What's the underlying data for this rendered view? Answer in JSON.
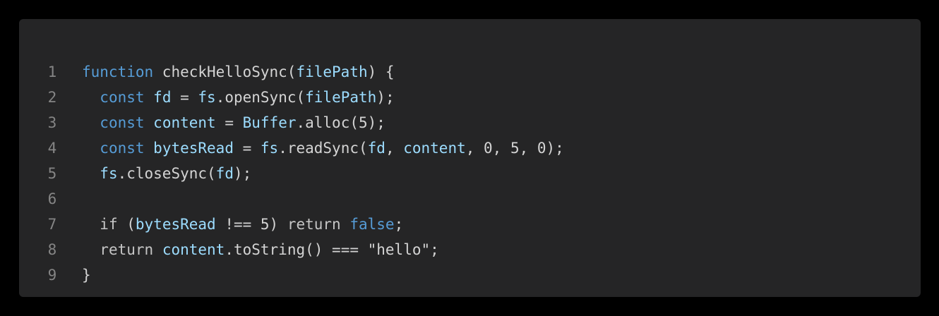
{
  "colors": {
    "background": "#000000",
    "panel": "#252526",
    "text": "#d4d4d4",
    "line_number": "#858585",
    "keyword": "#569cd6",
    "variable": "#9cdcfe"
  },
  "code": {
    "line_numbers": [
      "1",
      "2",
      "3",
      "4",
      "5",
      "6",
      "7",
      "8",
      "9"
    ],
    "lines": [
      [
        {
          "t": "function",
          "k": "kw"
        },
        {
          "t": " checkHelloSync(",
          "k": "fn"
        },
        {
          "t": "filePath",
          "k": "var"
        },
        {
          "t": ") {",
          "k": "punc"
        }
      ],
      [
        {
          "t": "  ",
          "k": "punc"
        },
        {
          "t": "const",
          "k": "kw"
        },
        {
          "t": " ",
          "k": "punc"
        },
        {
          "t": "fd",
          "k": "var"
        },
        {
          "t": " = ",
          "k": "punc"
        },
        {
          "t": "fs",
          "k": "var"
        },
        {
          "t": ".openSync(",
          "k": "fn"
        },
        {
          "t": "filePath",
          "k": "var"
        },
        {
          "t": ");",
          "k": "punc"
        }
      ],
      [
        {
          "t": "  ",
          "k": "punc"
        },
        {
          "t": "const",
          "k": "kw"
        },
        {
          "t": " ",
          "k": "punc"
        },
        {
          "t": "content",
          "k": "var"
        },
        {
          "t": " = ",
          "k": "punc"
        },
        {
          "t": "Buffer",
          "k": "var"
        },
        {
          "t": ".alloc(5);",
          "k": "fn"
        }
      ],
      [
        {
          "t": "  ",
          "k": "punc"
        },
        {
          "t": "const",
          "k": "kw"
        },
        {
          "t": " ",
          "k": "punc"
        },
        {
          "t": "bytesRead",
          "k": "var"
        },
        {
          "t": " = ",
          "k": "punc"
        },
        {
          "t": "fs",
          "k": "var"
        },
        {
          "t": ".readSync(",
          "k": "fn"
        },
        {
          "t": "fd",
          "k": "var"
        },
        {
          "t": ", ",
          "k": "punc"
        },
        {
          "t": "content",
          "k": "var"
        },
        {
          "t": ", 0, 5, 0);",
          "k": "punc"
        }
      ],
      [
        {
          "t": "  ",
          "k": "punc"
        },
        {
          "t": "fs",
          "k": "var"
        },
        {
          "t": ".closeSync(",
          "k": "fn"
        },
        {
          "t": "fd",
          "k": "var"
        },
        {
          "t": ");",
          "k": "punc"
        }
      ],
      [],
      [
        {
          "t": "  ",
          "k": "punc"
        },
        {
          "t": "if",
          "k": "ctl"
        },
        {
          "t": " (",
          "k": "punc"
        },
        {
          "t": "bytesRead",
          "k": "var"
        },
        {
          "t": " !== 5) ",
          "k": "punc"
        },
        {
          "t": "return",
          "k": "ctl"
        },
        {
          "t": " ",
          "k": "punc"
        },
        {
          "t": "false",
          "k": "kw"
        },
        {
          "t": ";",
          "k": "punc"
        }
      ],
      [
        {
          "t": "  ",
          "k": "punc"
        },
        {
          "t": "return",
          "k": "ctl"
        },
        {
          "t": " ",
          "k": "punc"
        },
        {
          "t": "content",
          "k": "var"
        },
        {
          "t": ".toString() === ",
          "k": "fn"
        },
        {
          "t": "\"hello\"",
          "k": "str"
        },
        {
          "t": ";",
          "k": "punc"
        }
      ],
      [
        {
          "t": "}",
          "k": "punc"
        }
      ]
    ]
  }
}
